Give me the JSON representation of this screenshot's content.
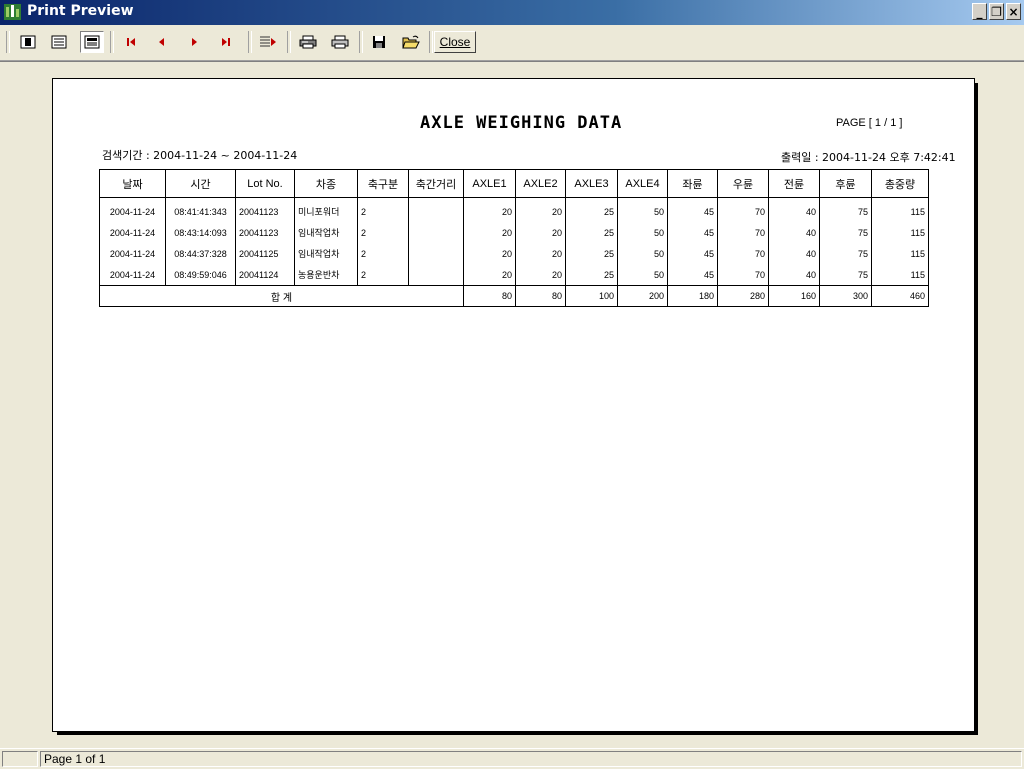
{
  "window": {
    "title": "Print Preview"
  },
  "toolbar": {
    "close_label": "Close"
  },
  "report": {
    "title": "AXLE WEIGHING DATA",
    "page_indicator": "PAGE [  1  /  1  ]",
    "search_period": "검색기간 : 2004-11-24 ~ 2004-11-24",
    "print_date": "출력일 : 2004-11-24 오후 7:42:41",
    "columns": [
      "날짜",
      "시간",
      "Lot No.",
      "차종",
      "축구분",
      "축간거리",
      "AXLE1",
      "AXLE2",
      "AXLE3",
      "AXLE4",
      "좌륜",
      "우륜",
      "전륜",
      "후륜",
      "총중량"
    ],
    "rows": [
      [
        "2004-11-24",
        "08:41:41:343",
        "20041123",
        "미니포워더",
        "2",
        "",
        "20",
        "20",
        "25",
        "50",
        "45",
        "70",
        "40",
        "75",
        "115"
      ],
      [
        "2004-11-24",
        "08:43:14:093",
        "20041123",
        "임내작업차",
        "2",
        "",
        "20",
        "20",
        "25",
        "50",
        "45",
        "70",
        "40",
        "75",
        "115"
      ],
      [
        "2004-11-24",
        "08:44:37:328",
        "20041125",
        "임내작업차",
        "2",
        "",
        "20",
        "20",
        "25",
        "50",
        "45",
        "70",
        "40",
        "75",
        "115"
      ],
      [
        "2004-11-24",
        "08:49:59:046",
        "20041124",
        "농용운반차",
        "2",
        "",
        "20",
        "20",
        "25",
        "50",
        "45",
        "70",
        "40",
        "75",
        "115"
      ]
    ],
    "total_label": "합  계",
    "totals": [
      "80",
      "80",
      "100",
      "200",
      "180",
      "280",
      "160",
      "300",
      "460"
    ]
  },
  "status": {
    "page_text": "Page 1 of 1"
  }
}
